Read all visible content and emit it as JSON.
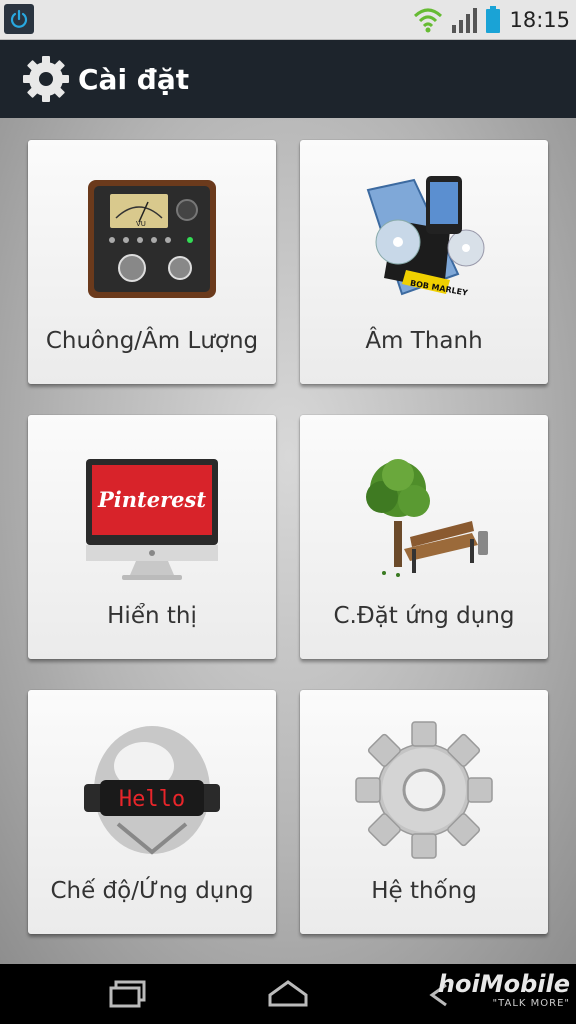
{
  "status_bar": {
    "time": "18:15",
    "icons": [
      "power-icon",
      "wifi-icon",
      "signal-icon",
      "battery-icon"
    ]
  },
  "action_bar": {
    "title": "Cài đặt",
    "icon": "gear-icon"
  },
  "tiles": [
    {
      "label": "Chuông/Âm Lượng",
      "icon": "audio-meter-icon"
    },
    {
      "label": "Âm Thanh",
      "icon": "media-player-icon"
    },
    {
      "label": "Hiển thị",
      "icon": "monitor-icon",
      "screen_text": "Pinterest"
    },
    {
      "label": "C.Đặt ứng dụng",
      "icon": "tree-bench-icon"
    },
    {
      "label": "Chế độ/Ứng dụng",
      "icon": "helmet-icon",
      "visor_text": "Hello"
    },
    {
      "label": "Hệ thống",
      "icon": "system-gear-icon"
    }
  ],
  "nav_bar": {
    "buttons": [
      "recent-apps-icon",
      "home-icon",
      "back-icon"
    ],
    "watermark": {
      "main": "hoiMobile",
      "sub": "\"TALK MORE\""
    }
  },
  "colors": {
    "action_bar_bg": "#1d242c",
    "status_bar_bg": "#e6e6e6",
    "battery": "#1aa3d6",
    "tile_bg": "#f5f5f5"
  }
}
